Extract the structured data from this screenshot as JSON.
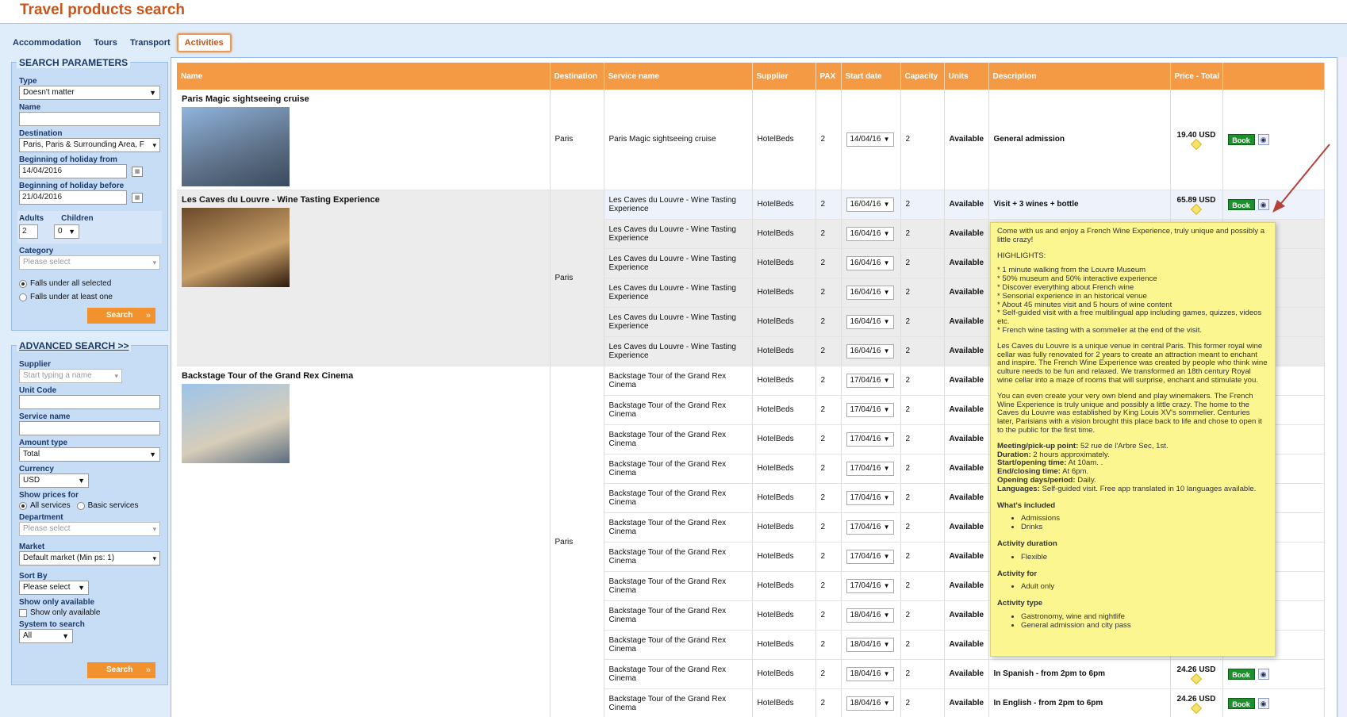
{
  "app": {
    "title": "Travel products search"
  },
  "tabs": [
    {
      "label": "Accommodation"
    },
    {
      "label": "Tours"
    },
    {
      "label": "Transport"
    },
    {
      "label": "Activities"
    }
  ],
  "search": {
    "legend": "SEARCH PARAMETERS",
    "type_label": "Type",
    "type_value": "Doesn't matter",
    "name_label": "Name",
    "name_value": "",
    "destination_label": "Destination",
    "destination_value": "Paris, Paris & Surrounding Area, F",
    "from_label": "Beginning of holiday from",
    "from_value": "14/04/2016",
    "before_label": "Beginning of holiday before",
    "before_value": "21/04/2016",
    "adults_label": "Adults",
    "adults_value": "2",
    "children_label": "Children",
    "children_value": "0",
    "category_label": "Category",
    "category_placeholder": "Please select",
    "radio_all": "Falls under all selected",
    "radio_one": "Falls under at least one",
    "search_button": "Search"
  },
  "advanced": {
    "legend": "ADVANCED SEARCH >>",
    "supplier_label": "Supplier",
    "supplier_placeholder": "Start typing a name",
    "unit_code_label": "Unit Code",
    "service_name_label": "Service name",
    "amount_type_label": "Amount type",
    "amount_type_value": "Total",
    "currency_label": "Currency",
    "currency_value": "USD",
    "show_prices_label": "Show prices for",
    "all_services": "All services",
    "basic_services": "Basic services",
    "department_label": "Department",
    "department_placeholder": "Please select",
    "market_label": "Market",
    "market_value": "Default market (Min ps: 1)",
    "sort_label": "Sort By",
    "sort_value": "Please select",
    "show_only_label": "Show only available",
    "show_only_check": "Show only available",
    "system_label": "System to search",
    "system_value": "All",
    "search_button": "Search"
  },
  "table": {
    "headers": [
      "Name",
      "Destination",
      "Service name",
      "Supplier",
      "PAX",
      "Start date",
      "Capacity",
      "Units",
      "Description",
      "Price - Total",
      ""
    ],
    "book_label": "Book",
    "products": [
      {
        "name": "Paris Magic sightseeing cruise",
        "destination": "Paris"
      },
      {
        "name": "Les Caves du Louvre - Wine Tasting Experience",
        "destination": "Paris"
      },
      {
        "name": "Backstage Tour of the Grand Rex Cinema",
        "destination": "Paris"
      }
    ],
    "rows": [
      {
        "service": "Paris Magic sightseeing cruise",
        "supplier": "HotelBeds",
        "pax": "2",
        "date": "14/04/16",
        "capacity": "2",
        "units": "Available",
        "description": "General admission",
        "price": "19.40 USD"
      },
      {
        "service": "Les Caves du Louvre - Wine Tasting Experience",
        "supplier": "HotelBeds",
        "pax": "2",
        "date": "16/04/16",
        "capacity": "2",
        "units": "Available",
        "description": "Visit + 3 wines + bottle",
        "price": "65.89 USD"
      },
      {
        "service": "Les Caves du Louvre - Wine Tasting Experience",
        "supplier": "HotelBeds",
        "pax": "2",
        "date": "16/04/16",
        "capacity": "2",
        "units": "Available",
        "description": "",
        "price": ""
      },
      {
        "service": "Les Caves du Louvre - Wine Tasting Experience",
        "supplier": "HotelBeds",
        "pax": "2",
        "date": "16/04/16",
        "capacity": "2",
        "units": "Available",
        "description": "",
        "price": ""
      },
      {
        "service": "Les Caves du Louvre - Wine Tasting Experience",
        "supplier": "HotelBeds",
        "pax": "2",
        "date": "16/04/16",
        "capacity": "2",
        "units": "Available",
        "description": "",
        "price": ""
      },
      {
        "service": "Les Caves du Louvre - Wine Tasting Experience",
        "supplier": "HotelBeds",
        "pax": "2",
        "date": "16/04/16",
        "capacity": "2",
        "units": "Available",
        "description": "",
        "price": ""
      },
      {
        "service": "Les Caves du Louvre - Wine Tasting Experience",
        "supplier": "HotelBeds",
        "pax": "2",
        "date": "16/04/16",
        "capacity": "2",
        "units": "Available",
        "description": "",
        "price": ""
      },
      {
        "service": "Backstage Tour of the Grand Rex Cinema",
        "supplier": "HotelBeds",
        "pax": "2",
        "date": "17/04/16",
        "capacity": "2",
        "units": "Available",
        "description": "",
        "price": ""
      },
      {
        "service": "Backstage Tour of the Grand Rex Cinema",
        "supplier": "HotelBeds",
        "pax": "2",
        "date": "17/04/16",
        "capacity": "2",
        "units": "Available",
        "description": "",
        "price": ""
      },
      {
        "service": "Backstage Tour of the Grand Rex Cinema",
        "supplier": "HotelBeds",
        "pax": "2",
        "date": "17/04/16",
        "capacity": "2",
        "units": "Available",
        "description": "",
        "price": ""
      },
      {
        "service": "Backstage Tour of the Grand Rex Cinema",
        "supplier": "HotelBeds",
        "pax": "2",
        "date": "17/04/16",
        "capacity": "2",
        "units": "Available",
        "description": "",
        "price": ""
      },
      {
        "service": "Backstage Tour of the Grand Rex Cinema",
        "supplier": "HotelBeds",
        "pax": "2",
        "date": "17/04/16",
        "capacity": "2",
        "units": "Available",
        "description": "",
        "price": ""
      },
      {
        "service": "Backstage Tour of the Grand Rex Cinema",
        "supplier": "HotelBeds",
        "pax": "2",
        "date": "17/04/16",
        "capacity": "2",
        "units": "Available",
        "description": "",
        "price": ""
      },
      {
        "service": "Backstage Tour of the Grand Rex Cinema",
        "supplier": "HotelBeds",
        "pax": "2",
        "date": "17/04/16",
        "capacity": "2",
        "units": "Available",
        "description": "",
        "price": ""
      },
      {
        "service": "Backstage Tour of the Grand Rex Cinema",
        "supplier": "HotelBeds",
        "pax": "2",
        "date": "17/04/16",
        "capacity": "2",
        "units": "Available",
        "description": "",
        "price": ""
      },
      {
        "service": "Backstage Tour of the Grand Rex Cinema",
        "supplier": "HotelBeds",
        "pax": "2",
        "date": "18/04/16",
        "capacity": "2",
        "units": "Available",
        "description": "",
        "price": ""
      },
      {
        "service": "Backstage Tour of the Grand Rex Cinema",
        "supplier": "HotelBeds",
        "pax": "2",
        "date": "18/04/16",
        "capacity": "2",
        "units": "Available",
        "description": "",
        "price": ""
      },
      {
        "service": "Backstage Tour of the Grand Rex Cinema",
        "supplier": "HotelBeds",
        "pax": "2",
        "date": "18/04/16",
        "capacity": "2",
        "units": "Available",
        "description": "In Spanish - from 2pm to 6pm",
        "price": "24.26 USD"
      },
      {
        "service": "Backstage Tour of the Grand Rex Cinema",
        "supplier": "HotelBeds",
        "pax": "2",
        "date": "18/04/16",
        "capacity": "2",
        "units": "Available",
        "description": "In English - from 2pm to 6pm",
        "price": "24.26 USD"
      }
    ]
  },
  "tooltip": {
    "intro": "Come with us and enjoy a French Wine Experience, truly unique and possibly a little crazy!",
    "highlights_title": "HIGHLIGHTS:",
    "highlights": [
      "* 1 minute walking from the Louvre Museum",
      "* 50% museum and 50% interactive experience",
      "* Discover everything about French wine",
      "* Sensorial experience in an historical venue",
      "* About 45 minutes visit and 5 hours of wine content",
      "* Self-guided visit with a free multilingual app including games, quizzes, videos etc.",
      "* French wine tasting with a sommelier at the end of the visit."
    ],
    "para1": "Les Caves du Louvre is a unique venue in central Paris. This former royal wine cellar was fully renovated for 2 years to create an attraction meant to enchant and inspire. The French Wine Experience was created by people who think wine culture needs to be fun and relaxed. We transformed an 18th century Royal wine cellar into a maze of rooms that will surprise, enchant and stimulate you.",
    "para2": "You can even create your very own blend and play winemakers. The French Wine Experience is truly unique and possibly a little crazy. The home to the Caves du Louvre was established by King Louis XV's sommelier. Centuries later, Parisians with a vision brought this place back to life and chose to open it to the public for the first time.",
    "meeting_label": "Meeting/pick-up point:",
    "meeting": " 52 rue de l'Arbre Sec, 1st.",
    "duration_label": "Duration:",
    "duration": " 2 hours approximately.",
    "start_label": "Start/opening time:",
    "start": " At 10am. .",
    "end_label": "End/closing time:",
    "end": " At 6pm.",
    "days_label": "Opening days/period:",
    "days": " Daily.",
    "lang_label": "Languages:",
    "lang": " Self-guided visit. Free app translated in 10 languages available.",
    "included_title": "What's included",
    "included": [
      "Admissions",
      "Drinks"
    ],
    "duration_title": "Activity duration",
    "duration_items": [
      "Flexible"
    ],
    "for_title": "Activity for",
    "for_items": [
      "Adult only"
    ],
    "type_title": "Activity type",
    "type_items": [
      "Gastronomy, wine and nightlife",
      "General admission and city pass"
    ]
  }
}
